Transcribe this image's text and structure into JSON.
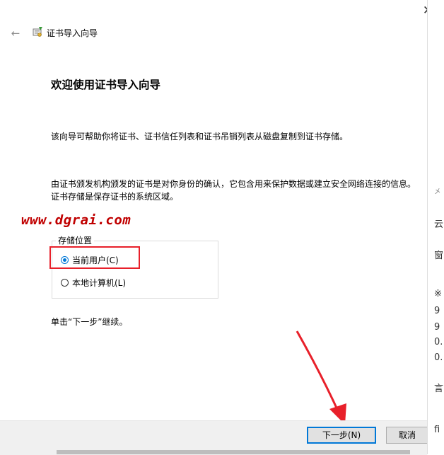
{
  "window": {
    "title": "证书导入向导",
    "close_glyph": "✕",
    "back_glyph": "←"
  },
  "main": {
    "heading": "欢迎使用证书导入向导",
    "intro": "该向导可帮助你将证书、证书信任列表和证书吊销列表从磁盘复制到证书存储。",
    "description": "由证书颁发机构颁发的证书是对你身份的确认，它包含用来保护数据或建立安全网络连接的信息。证书存储是保存证书的系统区域。",
    "store_location": {
      "legend": "存储位置",
      "options": [
        {
          "label": "当前用户(C)",
          "selected": true
        },
        {
          "label": "本地计算机(L)",
          "selected": false
        }
      ]
    },
    "continue_text": "单击“下一步”继续。"
  },
  "watermark": "www.dgrai.com",
  "footer": {
    "next_label": "下一步(N)",
    "cancel_label": "取消"
  },
  "background_glyphs": [
    "㐅",
    "云",
    "窗",
    "※",
    "9",
    "9",
    "0.",
    "0.",
    "言",
    "fi"
  ],
  "colors": {
    "accent": "#0078d7",
    "highlight": "#e8202a",
    "watermark": "#c00000"
  }
}
